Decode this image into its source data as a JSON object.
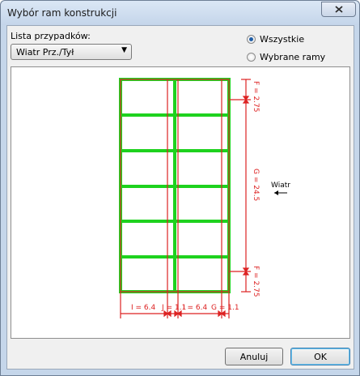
{
  "window": {
    "title": "Wybór ram konstrukcji"
  },
  "cases": {
    "label": "Lista przypadków:",
    "selected": "Wiatr Prz./Tył"
  },
  "radio": {
    "all_label": "Wszystkie",
    "selected_frames_label": "Wybrane ramy",
    "checked": "all"
  },
  "drawing": {
    "wind_label": "Wiatr",
    "dim_top": "F = 2.75",
    "dim_mid": "G = 24.5",
    "dim_bottom": "F = 2.75",
    "dim_x1": "I = 6.4",
    "dim_x2": "J = 1.1",
    "dim_x3": "I = 6.4",
    "dim_x4": "G = 1.1",
    "colors": {
      "frame": "#1ed21e",
      "dimension": "#dd2222"
    }
  },
  "buttons": {
    "cancel": "Anuluj",
    "ok": "OK"
  }
}
